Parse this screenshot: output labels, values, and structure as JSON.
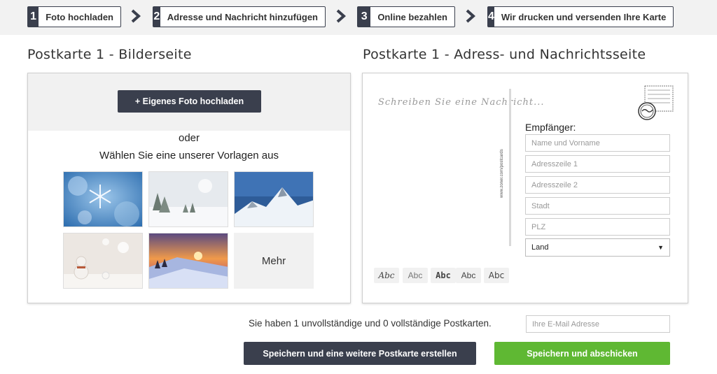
{
  "steps": [
    {
      "num": "1",
      "label": "Foto hochladen"
    },
    {
      "num": "2",
      "label": "Adresse und Nachricht hinzufügen"
    },
    {
      "num": "3",
      "label": "Online bezahlen"
    },
    {
      "num": "4",
      "label": "Wir drucken und versenden Ihre Karte"
    }
  ],
  "left": {
    "title": "Postkarte 1 - Bilderseite",
    "upload_button": "+ Eigenes Foto hochladen",
    "or_text": "oder",
    "choose_text": "Wählen Sie eine unserer Vorlagen aus",
    "more_label": "Mehr",
    "templates": [
      "snowflake",
      "snowy-forest",
      "snowy-mountains",
      "snowman",
      "winter-sunset"
    ]
  },
  "right": {
    "title": "Postkarte 1 - Adress- und Nachrichtsseite",
    "message_placeholder": "Schreiben Sie eine Nachricht...",
    "vertical_text": "www.zoner.com/postcards",
    "recipient_label": "Empfänger:",
    "fields": {
      "name": "Name und Vorname",
      "address1": "Adresszeile 1",
      "address2": "Adresszeile 2",
      "city": "Stadt",
      "zip": "PLZ"
    },
    "country_select": "Land",
    "font_options": [
      "Abc",
      "Abc",
      "Abc",
      "Abc",
      "Abc"
    ]
  },
  "footer": {
    "status": "Sie haben 1 unvollständige und 0 vollständige Postkarten.",
    "email_placeholder": "Ihre E-Mail Adresse",
    "save_more_button": "Speichern und eine weitere Postkarte erstellen",
    "save_send_button": "Speichern und abschicken"
  },
  "colors": {
    "dark": "#3a3f4d",
    "green": "#5fb833",
    "steps_bg": "#f2f2f2"
  },
  "icons": [
    "chevron-right-icon",
    "postage-stamp-icon"
  ]
}
